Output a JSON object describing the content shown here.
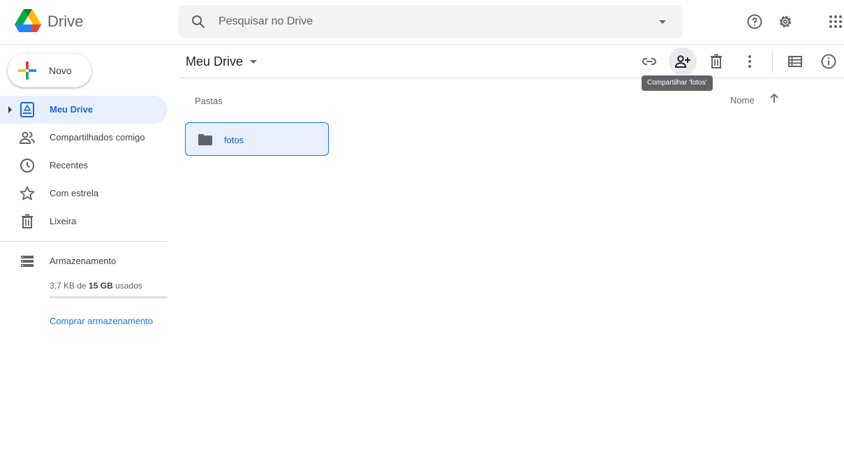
{
  "app": {
    "name": "Drive"
  },
  "search": {
    "placeholder": "Pesquisar no Drive"
  },
  "header_icons": [
    "help-icon",
    "settings-icon",
    "apps-grid-icon"
  ],
  "sidebar": {
    "new_button": "Novo",
    "items": [
      {
        "label": "Meu Drive",
        "icon": "my-drive-icon",
        "active": true
      },
      {
        "label": "Compartilhados comigo",
        "icon": "shared-icon",
        "active": false
      },
      {
        "label": "Recentes",
        "icon": "clock-icon",
        "active": false
      },
      {
        "label": "Com estrela",
        "icon": "star-icon",
        "active": false
      },
      {
        "label": "Lixeira",
        "icon": "trash-icon",
        "active": false
      }
    ],
    "storage": {
      "label": "Armazenamento",
      "used": "3,7 KB",
      "of": " de ",
      "total": "15 GB",
      "suffix": " usados",
      "used_fraction": 0.0
    },
    "buy_storage": "Comprar armazenamento"
  },
  "toolbar": {
    "breadcrumb": "Meu Drive",
    "tooltip": "Compartilhar 'fotos'",
    "actions": [
      "link-icon",
      "share-person-add-icon",
      "trash-icon",
      "more-vert-icon",
      "list-view-icon",
      "info-icon"
    ]
  },
  "content": {
    "section": "Pastas",
    "sort_by": "Nome",
    "folders": [
      {
        "name": "fotos"
      }
    ]
  },
  "colors": {
    "accent": "#1a73e8",
    "active_bg": "#e8f0fe"
  }
}
